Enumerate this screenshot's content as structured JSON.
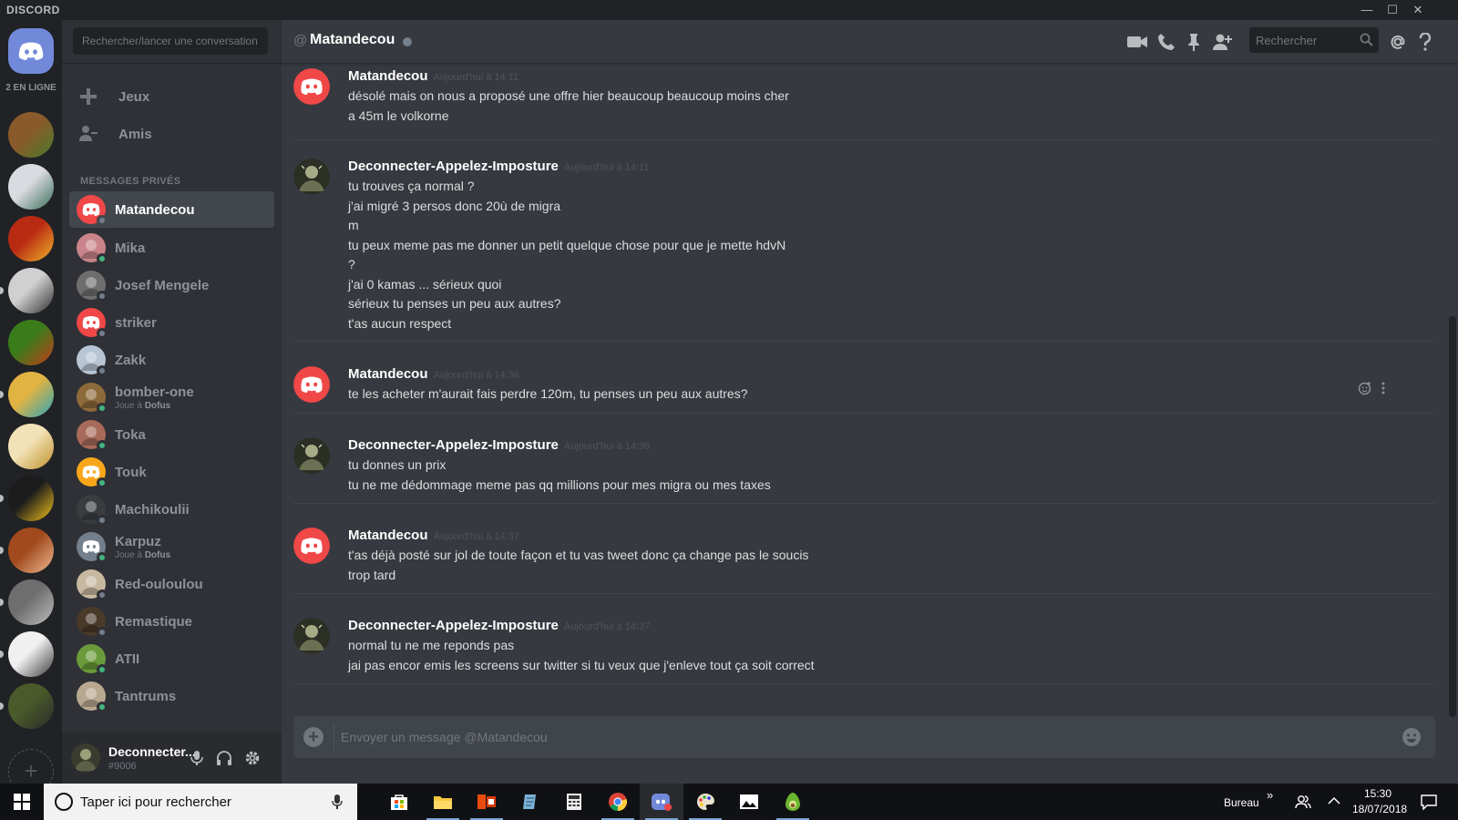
{
  "window": {
    "brand": "DISCORD",
    "minimize": "—",
    "maximize": "☐",
    "close": "✕"
  },
  "rail": {
    "online_count": "2 EN LIGNE",
    "add_server": "+",
    "servers": [
      {
        "name": "server-1",
        "colors": [
          "#8a5a2c",
          "#4c7a2a"
        ]
      },
      {
        "name": "server-2",
        "colors": [
          "#d9dbe0",
          "#3a6e5a"
        ]
      },
      {
        "name": "server-3",
        "colors": [
          "#b82a12",
          "#f0b32a"
        ]
      },
      {
        "name": "server-4",
        "colors": [
          "#d0d0d0",
          "#303030"
        ]
      },
      {
        "name": "server-5",
        "colors": [
          "#3b7c1a",
          "#c43a1a"
        ]
      },
      {
        "name": "server-6",
        "colors": [
          "#e1b342",
          "#2aa6b8"
        ]
      },
      {
        "name": "server-7",
        "colors": [
          "#f2e2b7",
          "#c0902a"
        ]
      },
      {
        "name": "server-8",
        "colors": [
          "#1c1c1c",
          "#f2c21a"
        ]
      },
      {
        "name": "server-9",
        "colors": [
          "#a04a1e",
          "#f0b890"
        ]
      },
      {
        "name": "server-10",
        "colors": [
          "#6e6e6e",
          "#bdbdbd"
        ]
      },
      {
        "name": "server-11",
        "colors": [
          "#f0f0f0",
          "#3c3c3c"
        ]
      },
      {
        "name": "server-12",
        "colors": [
          "#4a5a2a",
          "#2a2a2a"
        ]
      }
    ]
  },
  "sidebar": {
    "search_placeholder": "Rechercher/lancer une conversation",
    "nav": [
      {
        "label": "Jeux"
      },
      {
        "label": "Amis"
      }
    ],
    "section_label": "MESSAGES PRIVÉS",
    "dms": [
      {
        "name": "Matandecou",
        "status": "#747f8d",
        "avatar": "discord",
        "avatar_color": "#f04747",
        "activity": ""
      },
      {
        "name": "Mika",
        "status": "#43b581",
        "avatar": "photo",
        "avatar_color": "#c9848a",
        "activity": ""
      },
      {
        "name": "Josef Mengele",
        "status": "#747f8d",
        "avatar": "photo",
        "avatar_color": "#6e6e6e",
        "activity": ""
      },
      {
        "name": "striker",
        "status": "#747f8d",
        "avatar": "discord",
        "avatar_color": "#f04747",
        "activity": ""
      },
      {
        "name": "Zakk",
        "status": "#747f8d",
        "avatar": "photo",
        "avatar_color": "#b7c5d4",
        "activity": ""
      },
      {
        "name": "bomber-one",
        "status": "#43b581",
        "avatar": "photo",
        "avatar_color": "#8d6a3a",
        "activity_prefix": "Joue à",
        "activity_game": "Dofus"
      },
      {
        "name": "Toka",
        "status": "#43b581",
        "avatar": "photo",
        "avatar_color": "#a86a5a",
        "activity": ""
      },
      {
        "name": "Touk",
        "status": "#43b581",
        "avatar": "discord",
        "avatar_color": "#faa61a",
        "activity": ""
      },
      {
        "name": "Machikoulii",
        "status": "#747f8d",
        "avatar": "photo",
        "avatar_color": "#3a3c40",
        "activity": ""
      },
      {
        "name": "Karpuz",
        "status": "#43b581",
        "avatar": "discord",
        "avatar_color": "#747f8d",
        "activity_prefix": "Joue à",
        "activity_game": "Dofus"
      },
      {
        "name": "Red-ouloulou",
        "status": "#747f8d",
        "avatar": "photo",
        "avatar_color": "#c7b8a0",
        "activity": ""
      },
      {
        "name": "Remastique",
        "status": "#747f8d",
        "avatar": "photo",
        "avatar_color": "#4a3a2a",
        "activity": ""
      },
      {
        "name": "ATII",
        "status": "#43b581",
        "avatar": "photo",
        "avatar_color": "#6a9a3a",
        "activity": ""
      },
      {
        "name": "Tantrums",
        "status": "#43b581",
        "avatar": "photo",
        "avatar_color": "#b8a890",
        "activity": ""
      }
    ]
  },
  "user_panel": {
    "name": "Deconnecter...",
    "tag": "#9006"
  },
  "chat": {
    "at": "@",
    "title": "Matandecou",
    "search_placeholder": "Rechercher",
    "composer_placeholder": "Envoyer un message @Matandecou",
    "composer_plus": "+",
    "messages": [
      {
        "author": "Matandecou",
        "avatar": "discord",
        "time": "Aujourd'hui à 14:11",
        "lines": [
          "désolé mais on nous a proposé une offre hier beaucoup beaucoup moins cher",
          "a 45m le volkorne"
        ]
      },
      {
        "author": "Deconnecter-Appelez-Imposture",
        "avatar": "photo",
        "time": "Aujourd'hui à 14:11",
        "lines": [
          "tu trouves ça normal ?",
          "j'ai migré 3 persos donc 20ù de migra",
          "m",
          "tu peux meme pas me donner un petit quelque chose pour que je mette hdvN",
          "?",
          "j'ai 0 kamas ... sérieux quoi",
          "sérieux tu penses un peu aux autres?",
          "t'as aucun respect"
        ]
      },
      {
        "author": "Matandecou",
        "avatar": "discord",
        "time": "Aujourd'hui à 14:36",
        "lines": [
          "te les acheter m'aurait fais perdre 120m, tu penses un peu aux autres?"
        ]
      },
      {
        "author": "Deconnecter-Appelez-Imposture",
        "avatar": "photo",
        "time": "Aujourd'hui à 14:36",
        "lines": [
          "tu donnes un prix",
          "tu ne me dédommage meme pas qq millions pour mes migra ou mes taxes"
        ]
      },
      {
        "author": "Matandecou",
        "avatar": "discord",
        "time": "Aujourd'hui à 14:37",
        "lines": [
          "t'as déjà posté sur jol de toute façon et tu vas tweet donc ça change pas le soucis",
          "trop tard"
        ]
      },
      {
        "author": "Deconnecter-Appelez-Imposture",
        "avatar": "photo",
        "time": "Aujourd'hui à 14:37",
        "lines": [
          "normal tu ne me reponds pas",
          "jai pas encor emis les screens sur twitter si tu veux que j'enleve tout ça soit correct"
        ]
      }
    ]
  },
  "taskbar": {
    "search_placeholder": "Taper ici pour rechercher",
    "desktop_label": "Bureau",
    "chevron": "»",
    "time": "15:30",
    "date": "18/07/2018"
  },
  "colors": {
    "discord_blurple": "#7289da",
    "online": "#43b581",
    "offline": "#747f8d"
  }
}
